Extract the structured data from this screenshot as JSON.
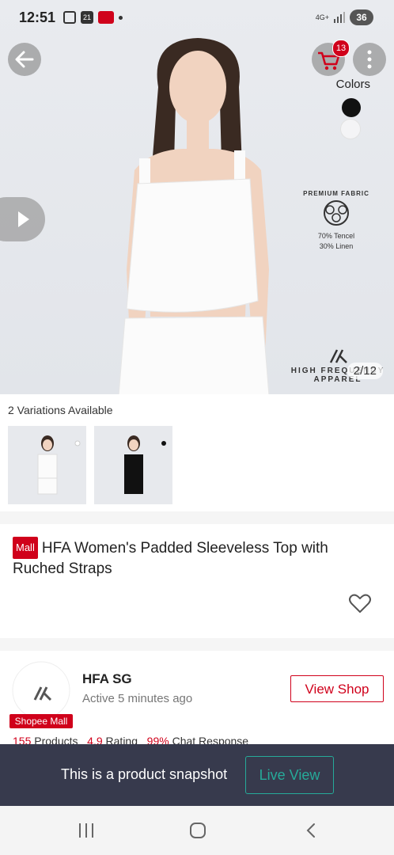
{
  "status_bar": {
    "time": "12:51",
    "calendar_day": "21",
    "network": "4G+",
    "battery": "36"
  },
  "gallery": {
    "cart_count": "13",
    "colors_label": "Colors",
    "colors": [
      "#111111",
      "#f4f4f6"
    ],
    "fabric_badge_title": "PREMIUM FABRIC",
    "fabric_line1": "70% Tencel",
    "fabric_line2": "30% Linen",
    "brand_line1": "HIGH FREQUENCY",
    "brand_line2": "APPAREL",
    "image_counter": "2/12"
  },
  "variations": {
    "label": "2 Variations Available"
  },
  "product": {
    "mall_tag": "Mall",
    "title": "HFA Women's Padded Sleeveless Top with Ruched Straps"
  },
  "shop": {
    "name": "HFA SG",
    "active": "Active 5 minutes ago",
    "view_shop_label": "View Shop",
    "logo_badge": "Shopee Mall",
    "products_count": "155",
    "products_label": "Products",
    "rating": "4.9",
    "rating_label": "Rating",
    "chat_response": "99%",
    "chat_label": "Chat Response"
  },
  "snapshot_bar": {
    "message": "This is a product snapshot",
    "live_view_label": "Live View"
  }
}
